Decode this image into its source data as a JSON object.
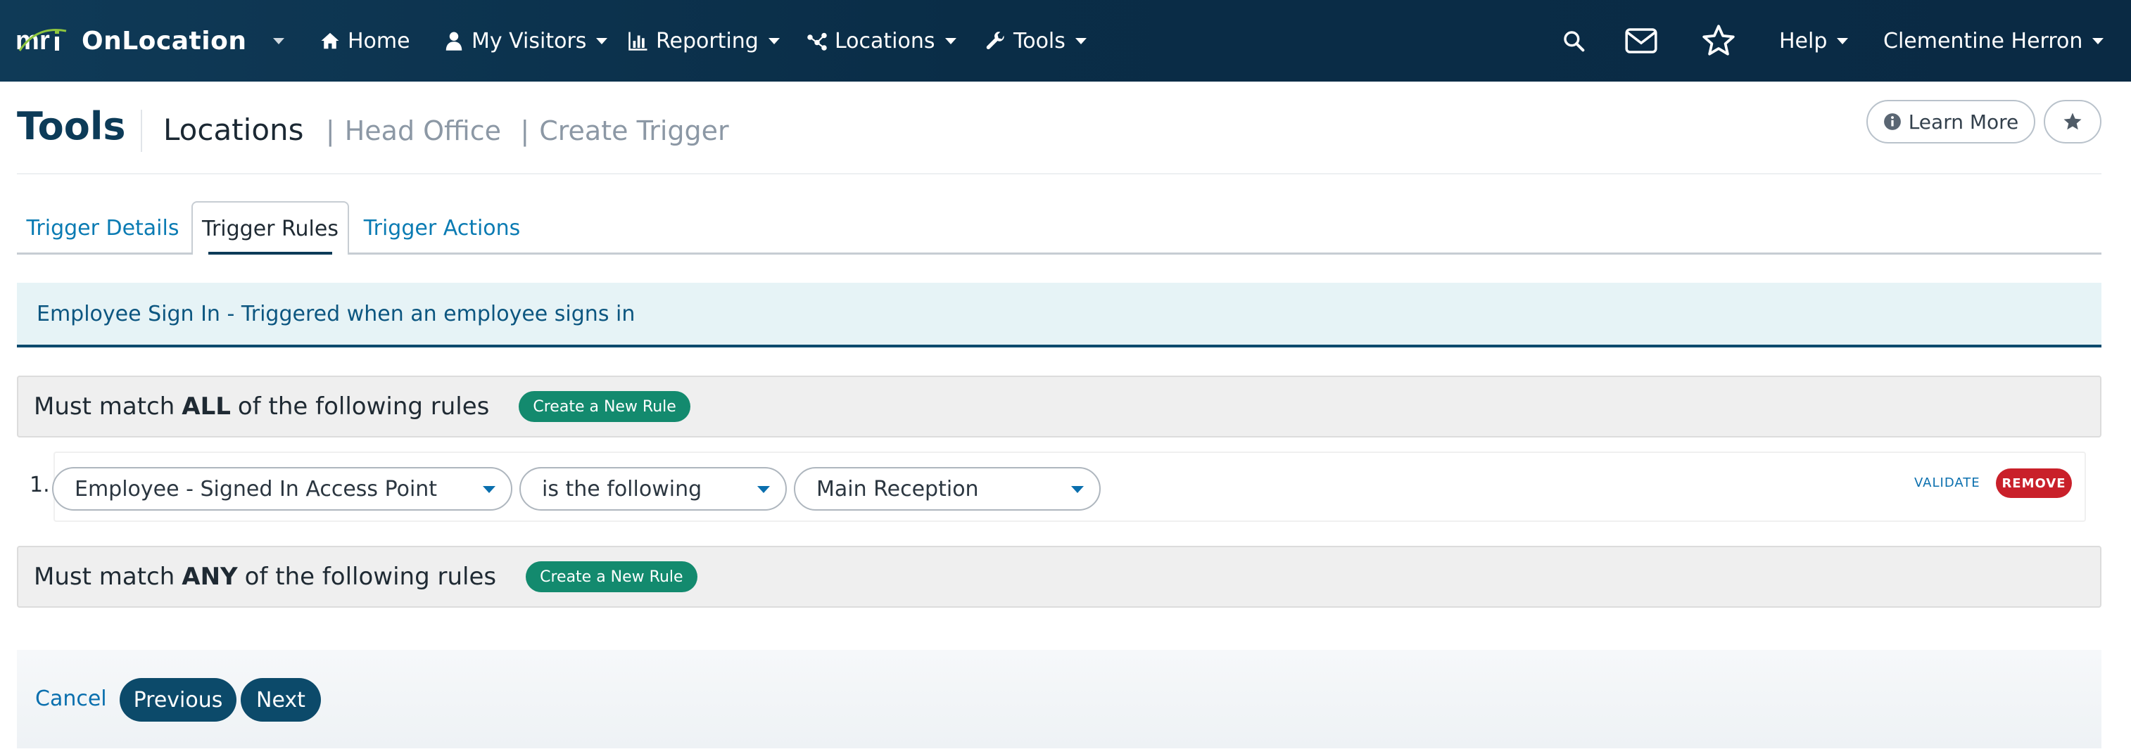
{
  "app": {
    "brand_logo_text": "mri",
    "brand_name": "OnLocation"
  },
  "nav": {
    "home": "Home",
    "visitors": "My Visitors",
    "reporting": "Reporting",
    "locations": "Locations",
    "tools": "Tools",
    "help": "Help",
    "user": "Clementine Herron"
  },
  "header": {
    "section": "Tools",
    "crumb_main": "Locations",
    "crumb_1": "Head Office",
    "crumb_2": "Create Trigger",
    "separator": "|",
    "learn_more": "Learn More"
  },
  "tabs": [
    {
      "label": "Trigger Details",
      "active": false
    },
    {
      "label": "Trigger Rules",
      "active": true
    },
    {
      "label": "Trigger Actions",
      "active": false
    }
  ],
  "banner": {
    "text": "Employee Sign In - Triggered when an employee signs in"
  },
  "groups": {
    "all": {
      "prefix": "Must match",
      "keyword": "ALL",
      "suffix": "of the following rules",
      "button": "Create a New Rule"
    },
    "any": {
      "prefix": "Must match",
      "keyword": "ANY",
      "suffix": "of the following rules",
      "button": "Create a New Rule"
    }
  },
  "rule": {
    "number": "1.",
    "field": "Employee - Signed In Access Point",
    "operator": "is the following",
    "value": "Main Reception",
    "validate": "VALIDATE",
    "remove": "REMOVE"
  },
  "footer": {
    "cancel": "Cancel",
    "previous": "Previous",
    "next": "Next"
  },
  "colors": {
    "navbar": "#0f3a57",
    "primary": "#0c4a6a",
    "link": "#0a7bb3",
    "success": "#138a6e",
    "danger": "#c9202a"
  },
  "icons": [
    "mri-logo",
    "chevron-down-icon",
    "home-icon",
    "user-icon",
    "bar-chart-icon",
    "network-icon",
    "wrench-icon",
    "search-icon",
    "envelope-icon",
    "star-outline-icon",
    "info-circle-icon",
    "star-icon"
  ]
}
